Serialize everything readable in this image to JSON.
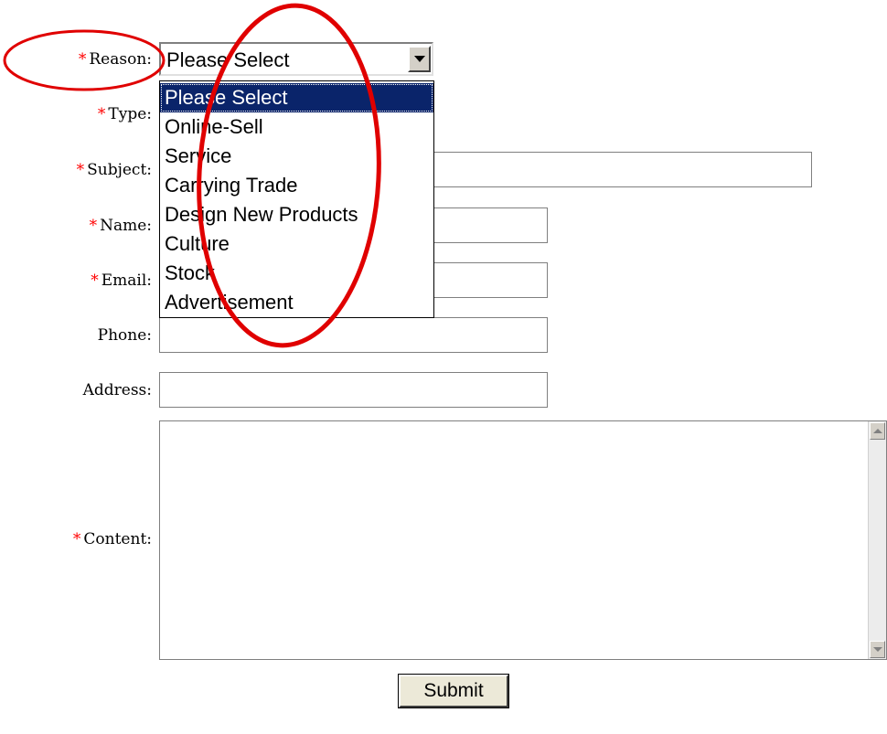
{
  "form": {
    "required_marker": "*",
    "reason": {
      "label": "Reason:",
      "selected": "Please Select"
    },
    "type": {
      "label": "Type:"
    },
    "subject": {
      "label": "Subject:",
      "value": ""
    },
    "name": {
      "label": "Name:",
      "value": ""
    },
    "email": {
      "label": "Email:",
      "value": ""
    },
    "phone": {
      "label": "Phone:",
      "value": ""
    },
    "address": {
      "label": "Address:",
      "value": ""
    },
    "content": {
      "label": "Content:",
      "value": ""
    },
    "submit_label": "Submit"
  },
  "dropdown": {
    "options": [
      "Please Select",
      "Online-Sell",
      "Service",
      "Carrying Trade",
      "Design New Products",
      "Culture",
      "Stock",
      "Advertisement"
    ],
    "highlighted_index": 0
  },
  "colors": {
    "required": "#ff0000",
    "highlight": "#0a246a",
    "annotation": "#e00000"
  },
  "icons": {
    "dropdown_button": "chevron-down-icon",
    "scroll_up": "arrow-up-icon",
    "scroll_down": "arrow-down-icon"
  }
}
